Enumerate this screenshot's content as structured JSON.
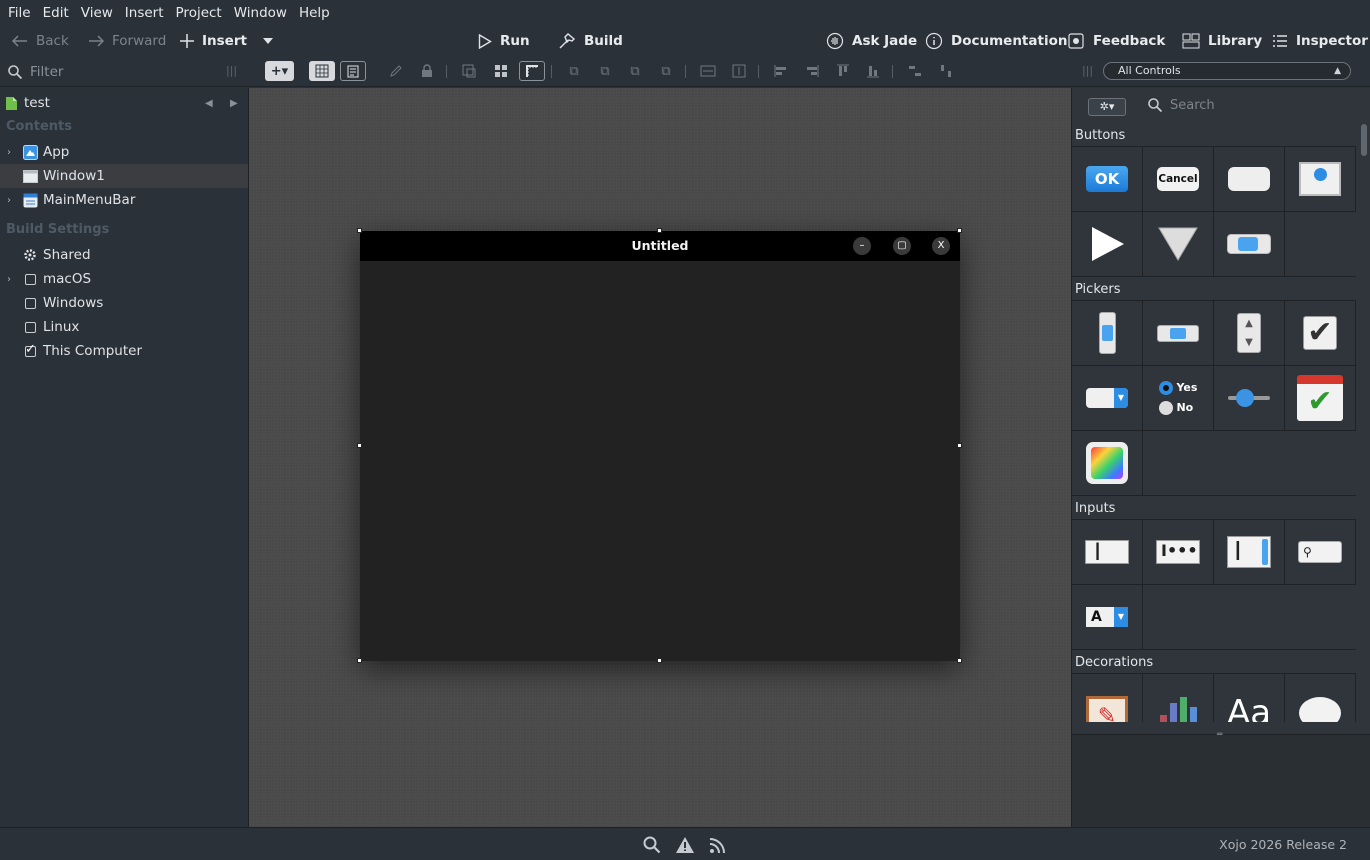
{
  "menu": [
    "File",
    "Edit",
    "View",
    "Insert",
    "Project",
    "Window",
    "Help"
  ],
  "toolbar": {
    "back": "Back",
    "forward": "Forward",
    "insert": "Insert",
    "run": "Run",
    "build": "Build",
    "ask_jade": "Ask Jade",
    "documentation": "Documentation",
    "feedback": "Feedback",
    "library": "Library",
    "inspector": "Inspector"
  },
  "filter": {
    "placeholder": "Filter"
  },
  "controls_select": {
    "value": "All Controls"
  },
  "navigator": {
    "project": "test",
    "contents_header": "Contents",
    "items": [
      "App",
      "Window1",
      "MainMenuBar"
    ],
    "build_header": "Build Settings",
    "build_items": [
      {
        "label": "Shared"
      },
      {
        "label": "macOS",
        "checked": false
      },
      {
        "label": "Windows",
        "checked": false
      },
      {
        "label": "Linux",
        "checked": false
      },
      {
        "label": "This Computer",
        "checked": true
      }
    ]
  },
  "window": {
    "title": "Untitled",
    "min_glyph": "–",
    "max_glyph": "▢",
    "close_glyph": "X"
  },
  "library": {
    "search_placeholder": "Search",
    "categories": [
      "Buttons",
      "Pickers",
      "Inputs",
      "Decorations"
    ],
    "button_ok": "OK",
    "button_cancel": "Cancel",
    "radio_yes": "Yes",
    "radio_no": "No",
    "label_aa": "Aa",
    "popup_a": "A"
  },
  "status": {
    "version": "Xojo 2026 Release 2"
  },
  "colors": {
    "accent": "#2c8fe6",
    "canvas": "#4a4a4a",
    "window_bg": "#222222"
  }
}
